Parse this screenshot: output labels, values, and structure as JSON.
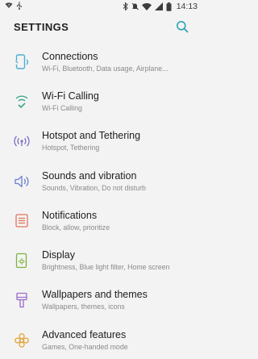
{
  "status_bar": {
    "time": "14:13"
  },
  "header": {
    "title": "SETTINGS"
  },
  "colors": {
    "background": "#f3f3f3",
    "accent": "#2ea3b7"
  },
  "items": [
    {
      "title": "Connections",
      "subtitle": "Wi-Fi, Bluetooth, Data usage, Airplane...",
      "icon": "connections-icon",
      "color": "#4aaed3"
    },
    {
      "title": "Wi-Fi Calling",
      "subtitle": "Wi-Fi Calling",
      "icon": "wifi-calling-icon",
      "color": "#3aa88a"
    },
    {
      "title": "Hotspot and Tethering",
      "subtitle": "Hotspot, Tethering",
      "icon": "hotspot-icon",
      "color": "#7d6fc7"
    },
    {
      "title": "Sounds and vibration",
      "subtitle": "Sounds, Vibration, Do not disturb",
      "icon": "sound-icon",
      "color": "#6c7fd0"
    },
    {
      "title": "Notifications",
      "subtitle": "Block, allow, prioritize",
      "icon": "notifications-icon",
      "color": "#e2745a"
    },
    {
      "title": "Display",
      "subtitle": "Brightness, Blue light filter, Home screen",
      "icon": "display-icon",
      "color": "#7fb23d"
    },
    {
      "title": "Wallpapers and themes",
      "subtitle": "Wallpapers, themes, icons",
      "icon": "wallpaper-icon",
      "color": "#9b6bc9"
    },
    {
      "title": "Advanced features",
      "subtitle": "Games, One-handed mode",
      "icon": "advanced-features-icon",
      "color": "#e1a53a"
    }
  ]
}
